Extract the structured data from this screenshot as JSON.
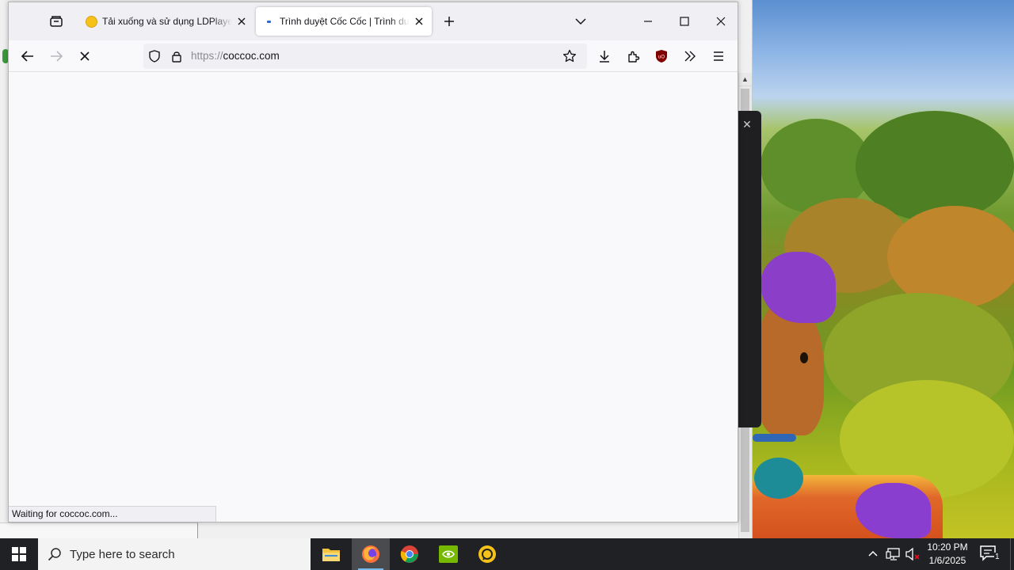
{
  "browser": {
    "tabs": [
      {
        "title": "Tải xuống và sử dụng LDPlayer",
        "favicon": "ldplayer-icon",
        "active": false
      },
      {
        "title": "Trình duyệt Cốc Cốc | Trình duyệt",
        "favicon": "loading-dot-icon",
        "active": true
      }
    ],
    "url": {
      "scheme": "https://",
      "host": "coccoc.com"
    },
    "status": "Waiting for coccoc.com..."
  },
  "taskbar": {
    "search_placeholder": "Type here to search",
    "apps": [
      "file-explorer-icon",
      "firefox-icon",
      "chrome-icon",
      "nvidia-icon",
      "ldplayer-icon"
    ],
    "clock": {
      "time": "10:20 PM",
      "date": "1/6/2025"
    },
    "notification_count": "1"
  },
  "colors": {
    "accent": "#0060df",
    "taskbar": "#202124",
    "tab_active": "#ffffff",
    "titlebar": "#f0f0f4"
  }
}
